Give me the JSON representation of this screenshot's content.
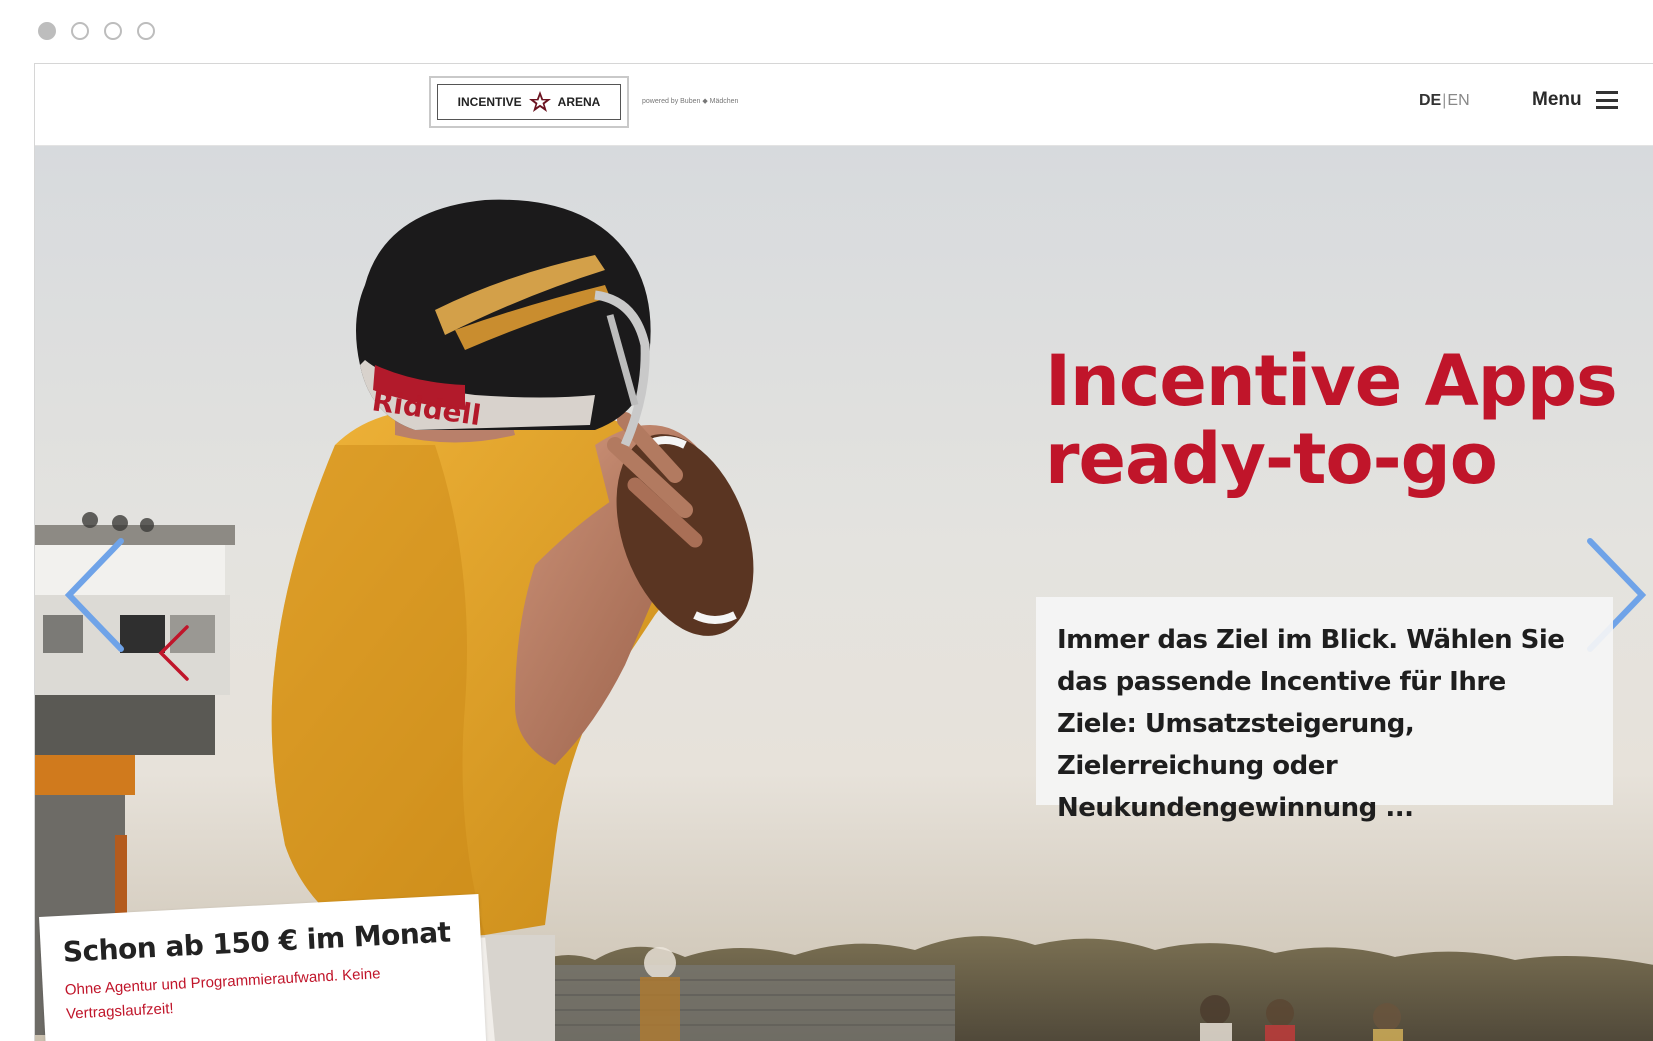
{
  "window": {
    "dots": [
      "window-dot-1",
      "window-dot-2",
      "window-dot-3",
      "window-dot-4"
    ]
  },
  "header": {
    "logo_left": "INCENTIVE",
    "logo_right": "ARENA",
    "powered_by": "powered by Buben ◆ Mädchen",
    "lang_active": "DE",
    "lang_sep": "|",
    "lang_other": "EN",
    "menu_label": "Menu"
  },
  "hero": {
    "headline_line1": "Incentive Apps",
    "headline_line2": "ready-to-go",
    "subtext": "Immer das Ziel im Blick. Wählen Sie das passende Incentive für Ihre Ziele: Umsatzsteigerung, Zielerreichung oder Neukundengewinnung ...",
    "helmet_text": "Riddell"
  },
  "price_card": {
    "title": "Schon ab 150 € im Monat",
    "subtitle": "Ohne Agentur und Programmieraufwand. Keine Vertragslaufzeit!"
  },
  "colors": {
    "brand_red": "#c0152a",
    "arrow_blue": "#6fa3e8",
    "jersey_gold": "#e2a020"
  },
  "icons": {
    "logo_star": "star-icon",
    "menu": "hamburger-icon",
    "prev": "chevron-left-icon",
    "next": "chevron-right-icon"
  }
}
